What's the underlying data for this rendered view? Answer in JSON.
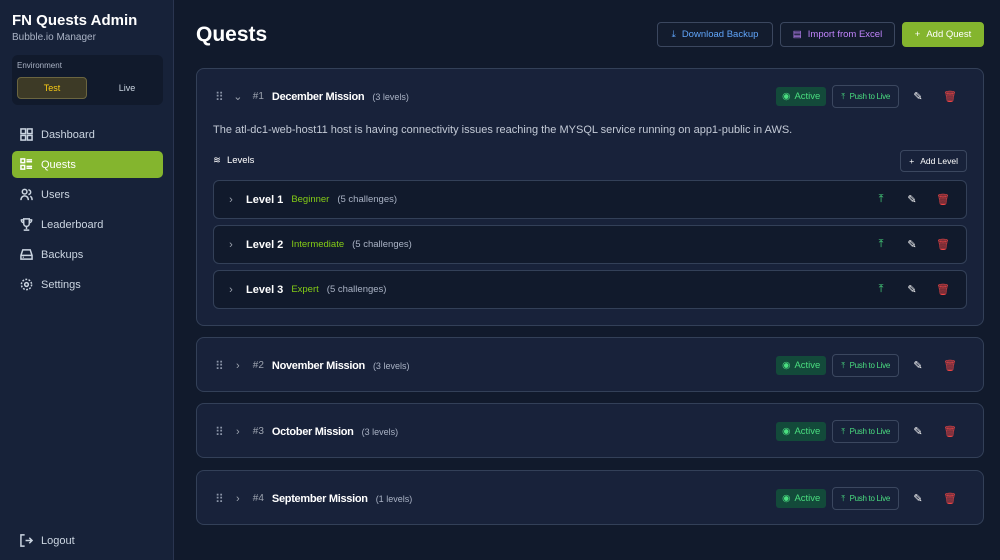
{
  "sidebar": {
    "title": "FN Quests Admin",
    "subtitle": "Bubble.io Manager",
    "environment": {
      "label": "Environment",
      "options": [
        "Test",
        "Live"
      ],
      "selected": "Test"
    },
    "items": [
      {
        "label": "Dashboard",
        "icon": "dashboard-icon"
      },
      {
        "label": "Quests",
        "icon": "list-icon",
        "active": true
      },
      {
        "label": "Users",
        "icon": "users-icon"
      },
      {
        "label": "Leaderboard",
        "icon": "trophy-icon"
      },
      {
        "label": "Backups",
        "icon": "hard-drive-icon"
      },
      {
        "label": "Settings",
        "icon": "gear-icon"
      }
    ],
    "logout": "Logout"
  },
  "header": {
    "title": "Quests",
    "download": "Download Backup",
    "import": "Import from Excel",
    "add": "Add Quest"
  },
  "colors": {
    "accent": "#84b52e",
    "active": "#4ade80",
    "danger": "#ef4444",
    "import": "#c084fc",
    "download": "#60a5fa"
  },
  "quests": [
    {
      "num": "#1",
      "title": "December Mission",
      "levels": "(3 levels)",
      "status": "Active",
      "push": "Push to Live",
      "expanded": true,
      "description": "The atl-dc1-web-host11 host is having connectivity issues reaching the MYSQL service running on app1-public in AWS.",
      "levels_label": "Levels",
      "add_level": "Add Level",
      "level_list": [
        {
          "name": "Level 1",
          "difficulty": "Beginner",
          "challenges": "(5 challenges)"
        },
        {
          "name": "Level 2",
          "difficulty": "Intermediate",
          "challenges": "(5 challenges)"
        },
        {
          "name": "Level 3",
          "difficulty": "Expert",
          "challenges": "(5 challenges)"
        }
      ]
    },
    {
      "num": "#2",
      "title": "November Mission",
      "levels": "(3 levels)",
      "status": "Active",
      "push": "Push to Live"
    },
    {
      "num": "#3",
      "title": "October Mission",
      "levels": "(3 levels)",
      "status": "Active",
      "push": "Push to Live"
    },
    {
      "num": "#4",
      "title": "September Mission",
      "levels": "(1 levels)",
      "status": "Active",
      "push": "Push to Live"
    }
  ]
}
